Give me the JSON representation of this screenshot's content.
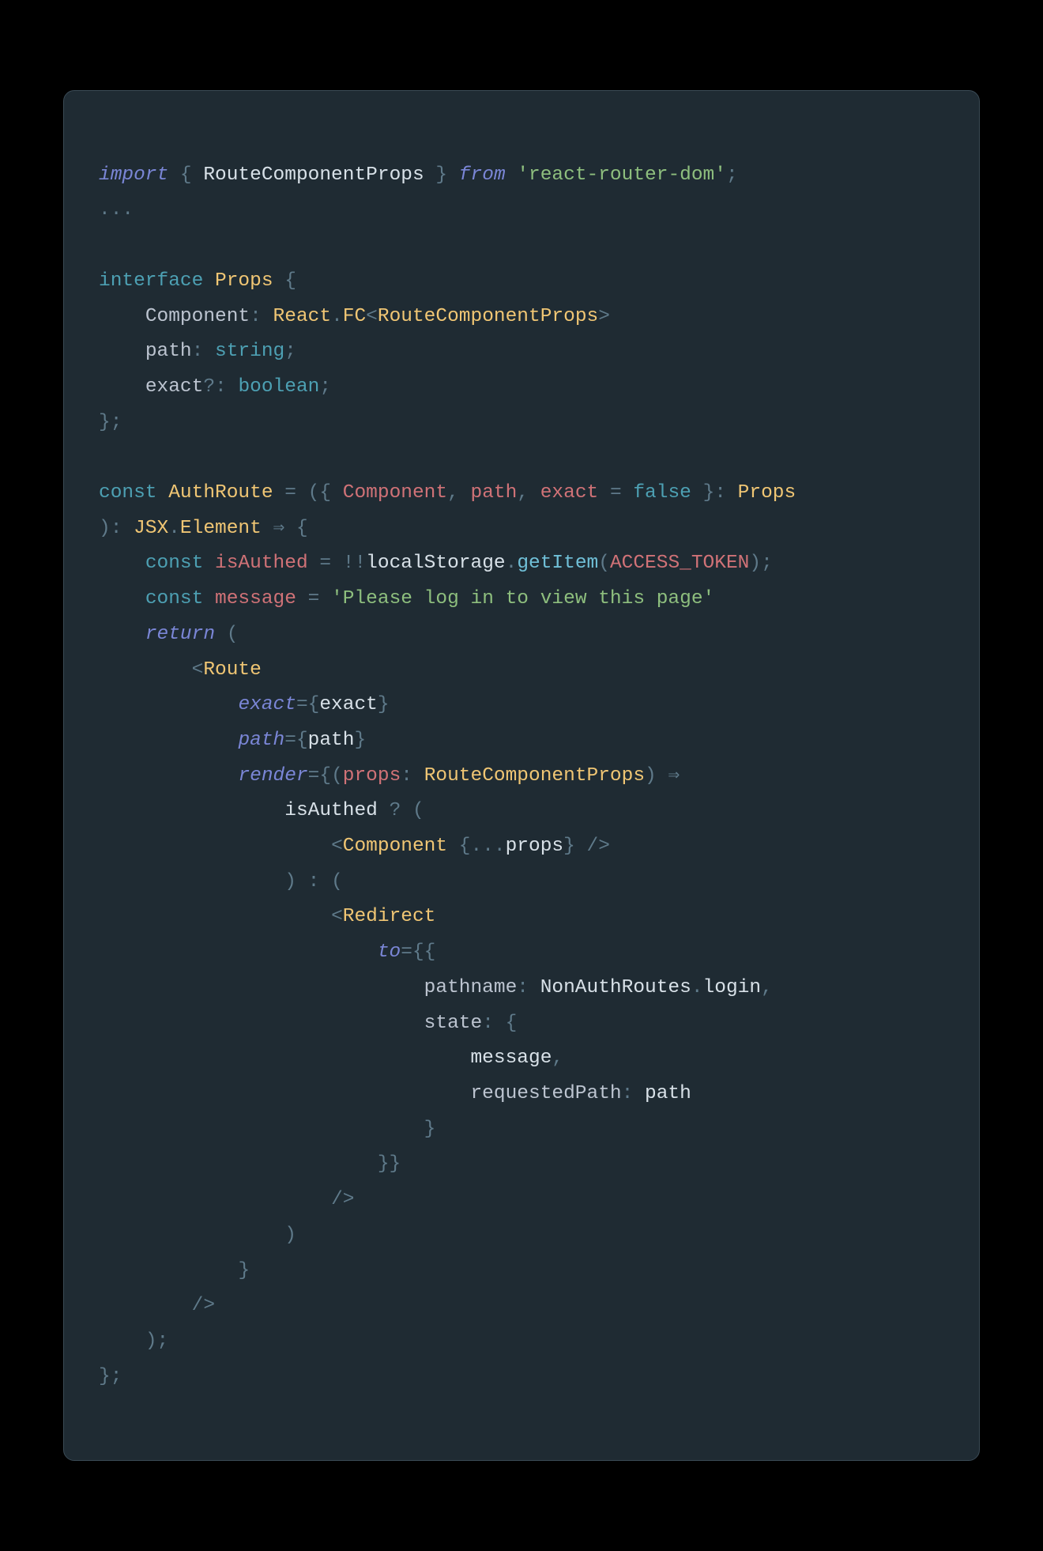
{
  "code": {
    "l01": {
      "import": "import",
      "brace_l": "{",
      "name": "RouteComponentProps",
      "brace_r": "}",
      "from": "from",
      "pkg": "'react-router-dom'",
      "semi": ";"
    },
    "l02": {
      "dots": "..."
    },
    "l04": {
      "interface": "interface",
      "name": "Props",
      "brace": "{"
    },
    "l05": {
      "indent": "    ",
      "key": "Component",
      "colon": ":",
      "react": "React",
      "dot": ".",
      "fc": "FC",
      "lt": "<",
      "gentype": "RouteComponentProps",
      "gt": ">"
    },
    "l06": {
      "indent": "    ",
      "key": "path",
      "colon": ":",
      "type": "string",
      "semi": ";"
    },
    "l07": {
      "indent": "    ",
      "key": "exact",
      "q": "?",
      "colon": ":",
      "type": "boolean",
      "semi": ";"
    },
    "l08": {
      "brace": "}",
      "semi": ";"
    },
    "l10": {
      "const": "const",
      "name": "AuthRoute",
      "eq": "=",
      "paren_l": "(",
      "brace_l": "{",
      "p1": "Component",
      "c1": ",",
      "p2": "path",
      "c2": ",",
      "p3": "exact",
      "eq2": "=",
      "false": "false",
      "brace_r": "}",
      "colon": ":",
      "props": "Props"
    },
    "l11": {
      "paren_close": ")",
      "colon": ":",
      "jsx": "JSX",
      "dot": ".",
      "element": "Element",
      "arrow": "⇒",
      "brace": "{"
    },
    "l12": {
      "indent": "    ",
      "const": "const",
      "name": "isAuthed",
      "eq": "=",
      "bangbang": "!!",
      "obj": "localStorage",
      "dot": ".",
      "fn": "getItem",
      "paren_l": "(",
      "arg": "ACCESS_TOKEN",
      "paren_r": ")",
      "semi": ";"
    },
    "l13": {
      "indent": "    ",
      "const": "const",
      "name": "message",
      "eq": "=",
      "str": "'Please log in to view this page'"
    },
    "l14": {
      "indent": "    ",
      "return": "return",
      "paren": "("
    },
    "l15": {
      "indent": "        ",
      "lt": "<",
      "tag": "Route"
    },
    "l16": {
      "indent": "            ",
      "attr": "exact",
      "eq": "=",
      "brace_l": "{",
      "val": "exact",
      "brace_r": "}"
    },
    "l17": {
      "indent": "            ",
      "attr": "path",
      "eq": "=",
      "brace_l": "{",
      "val": "path",
      "brace_r": "}"
    },
    "l18": {
      "indent": "            ",
      "attr": "render",
      "eq": "=",
      "brace_l": "{",
      "paren_l": "(",
      "param": "props",
      "colon": ":",
      "type": "RouteComponentProps",
      "paren_r": ")",
      "arrow": "⇒"
    },
    "l19": {
      "indent": "                ",
      "cond": "isAuthed",
      "q": "?",
      "paren": "("
    },
    "l20": {
      "indent": "                    ",
      "lt": "<",
      "tag": "Component",
      "brace_l": "{",
      "dots": "...",
      "props": "props",
      "brace_r": "}",
      "close": "/>"
    },
    "l21": {
      "indent": "                ",
      "paren_r": ")",
      "colon": ":",
      "paren_l": "("
    },
    "l22": {
      "indent": "                    ",
      "lt": "<",
      "tag": "Redirect"
    },
    "l23": {
      "indent": "                        ",
      "attr": "to",
      "eq": "=",
      "braces": "{{"
    },
    "l24": {
      "indent": "                            ",
      "key": "pathname",
      "colon": ":",
      "obj": "NonAuthRoutes",
      "dot": ".",
      "prop": "login",
      "comma": ","
    },
    "l25": {
      "indent": "                            ",
      "key": "state",
      "colon": ":",
      "brace": "{"
    },
    "l26": {
      "indent": "                                ",
      "name": "message",
      "comma": ","
    },
    "l27": {
      "indent": "                                ",
      "key": "requestedPath",
      "colon": ":",
      "val": "path"
    },
    "l28": {
      "indent": "                            ",
      "brace": "}"
    },
    "l29": {
      "indent": "                        ",
      "braces": "}}"
    },
    "l30": {
      "indent": "                    ",
      "close": "/>"
    },
    "l31": {
      "indent": "                ",
      "paren": ")"
    },
    "l32": {
      "indent": "            ",
      "brace": "}"
    },
    "l33": {
      "indent": "        ",
      "close": "/>"
    },
    "l34": {
      "indent": "    ",
      "paren": ")",
      "semi": ";"
    },
    "l35": {
      "brace": "}",
      "semi": ";"
    }
  }
}
